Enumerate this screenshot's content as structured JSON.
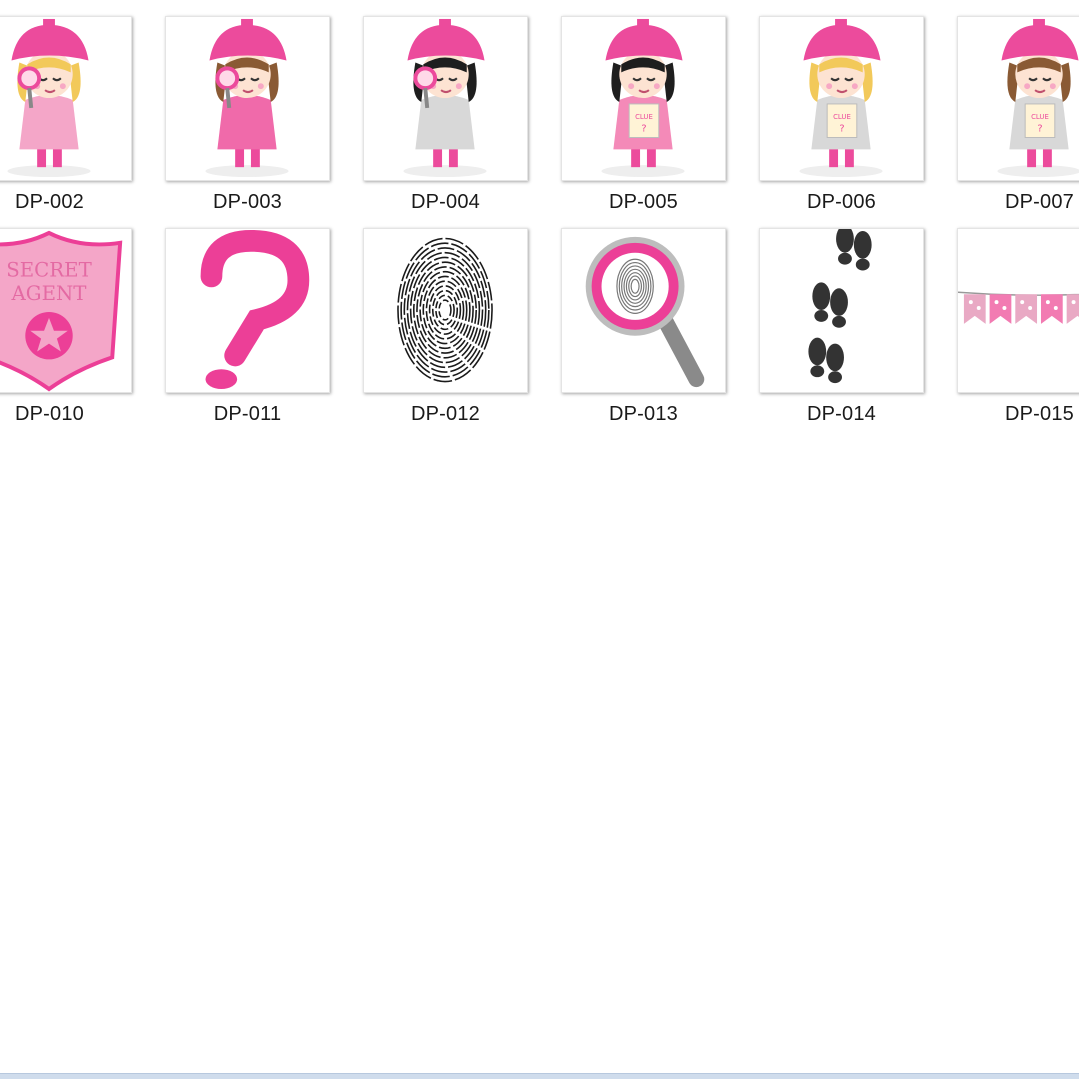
{
  "files": [
    {
      "name": "DP-002",
      "art": "detective-girl-icon",
      "variant": {
        "coat": "#f4a6c8",
        "hair": "#f2c95a",
        "pose": "magnifier"
      }
    },
    {
      "name": "DP-003",
      "art": "detective-girl-icon",
      "variant": {
        "coat": "#f06aaa",
        "hair": "#8a5a34",
        "pose": "magnifier"
      }
    },
    {
      "name": "DP-004",
      "art": "detective-girl-icon",
      "variant": {
        "coat": "#d8d8d8",
        "hair": "#1e1e1e",
        "pose": "magnifier"
      }
    },
    {
      "name": "DP-005",
      "art": "detective-girl-icon",
      "variant": {
        "coat": "#f48ab8",
        "hair": "#1e1e1e",
        "pose": "clue"
      }
    },
    {
      "name": "DP-006",
      "art": "detective-girl-icon",
      "variant": {
        "coat": "#d8d8d8",
        "hair": "#f2c95a",
        "pose": "clue"
      }
    },
    {
      "name": "DP-007",
      "art": "detective-girl-icon",
      "variant": {
        "coat": "#d8d8d8",
        "hair": "#8a5a34",
        "pose": "clue"
      }
    },
    {
      "name": "DP-010",
      "art": "secret-agent-badge-icon",
      "badge_text": [
        "SECRET",
        "AGENT"
      ]
    },
    {
      "name": "DP-011",
      "art": "question-mark-icon"
    },
    {
      "name": "DP-012",
      "art": "fingerprint-icon"
    },
    {
      "name": "DP-013",
      "art": "magnifying-glass-icon"
    },
    {
      "name": "DP-014",
      "art": "footprints-icon"
    },
    {
      "name": "DP-015",
      "art": "bunting-banner-icon"
    }
  ],
  "colors": {
    "pink": "#ec3f97",
    "light_pink": "#f4a6c8",
    "gray": "#8a8a8a",
    "dark": "#333333"
  }
}
